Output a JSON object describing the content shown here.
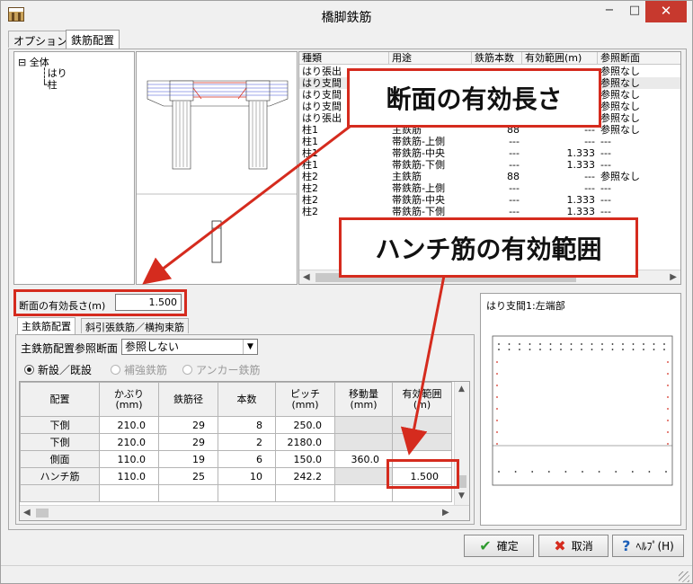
{
  "window": {
    "title": "橋脚鉄筋",
    "minimize": "−",
    "maximize": "□",
    "close": "✕"
  },
  "tabs": [
    "オプション",
    "鉄筋配置"
  ],
  "tree": {
    "root": "全体",
    "children": [
      "はり",
      "柱"
    ]
  },
  "grid": {
    "columns": [
      "種類",
      "用途",
      "鉄筋本数",
      "有効範囲(m)",
      "参照断面"
    ],
    "rows": [
      [
        "はり張出",
        "",
        "",
        "",
        "参照なし"
      ],
      [
        "はり支間",
        "",
        "",
        "",
        "参照なし"
      ],
      [
        "はり支間",
        "",
        "",
        "",
        "参照なし"
      ],
      [
        "はり支間",
        "",
        "",
        "",
        "参照なし"
      ],
      [
        "はり張出",
        "",
        "",
        "",
        "参照なし"
      ],
      [
        "柱1",
        "主鉄筋",
        "88",
        "---",
        "参照なし"
      ],
      [
        "柱1",
        "帯鉄筋-上側",
        "---",
        "---",
        "---"
      ],
      [
        "柱1",
        "帯鉄筋-中央",
        "---",
        "1.333",
        "---"
      ],
      [
        "柱1",
        "帯鉄筋-下側",
        "---",
        "1.333",
        "---"
      ],
      [
        "柱2",
        "主鉄筋",
        "88",
        "---",
        "参照なし"
      ],
      [
        "柱2",
        "帯鉄筋-上側",
        "---",
        "---",
        "---"
      ],
      [
        "柱2",
        "帯鉄筋-中央",
        "---",
        "1.333",
        "---"
      ],
      [
        "柱2",
        "帯鉄筋-下側",
        "---",
        "1.333",
        "---"
      ]
    ]
  },
  "effective_length": {
    "label": "断面の有効長さ(m)",
    "value": "1.500"
  },
  "subtabs": [
    "主鉄筋配置",
    "斜引張鉄筋／横拘束筋"
  ],
  "ref_section": {
    "label": "主鉄筋配置参照断面",
    "value": "参照しない"
  },
  "radios": [
    {
      "label": "新設／既設",
      "checked": true,
      "disabled": false
    },
    {
      "label": "補強鉄筋",
      "checked": false,
      "disabled": true
    },
    {
      "label": "アンカー鉄筋",
      "checked": false,
      "disabled": true
    }
  ],
  "bar_table": {
    "headers": [
      [
        "配置"
      ],
      [
        "かぶり",
        "(mm)"
      ],
      [
        "鉄筋径"
      ],
      [
        "本数"
      ],
      [
        "ピッチ",
        "(mm)"
      ],
      [
        "移動量",
        "(mm)"
      ],
      [
        "有効範囲",
        "(m)"
      ]
    ],
    "rows": [
      [
        "下側",
        "210.0",
        "29",
        "8",
        "250.0",
        "",
        ""
      ],
      [
        "下側",
        "210.0",
        "29",
        "2",
        "2180.0",
        "",
        ""
      ],
      [
        "側面",
        "110.0",
        "19",
        "6",
        "150.0",
        "360.0",
        ""
      ],
      [
        "ハンチ筋",
        "110.0",
        "25",
        "10",
        "242.2",
        "",
        "1.500"
      ]
    ]
  },
  "section_preview": {
    "title": "はり支間1:左端部"
  },
  "buttons": {
    "ok": "確定",
    "cancel": "取消",
    "help": "ﾍﾙﾌﾟ(H)"
  },
  "callouts": {
    "top": "断面の有効長さ",
    "bottom": "ハンチ筋の有効範囲"
  },
  "colors": {
    "accent_red": "#d52b1e",
    "close_red": "#c7392e",
    "ok_green": "#2e9a2e"
  }
}
